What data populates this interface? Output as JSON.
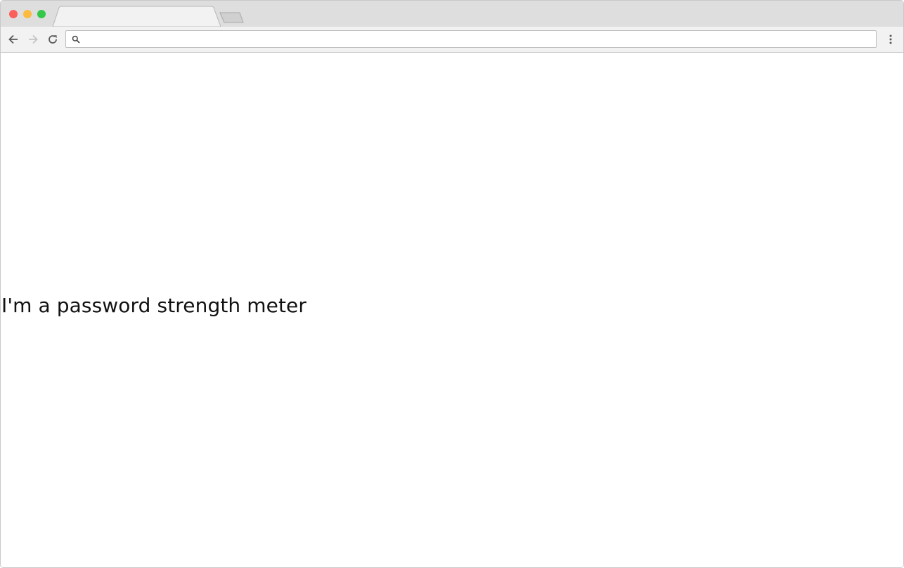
{
  "browser": {
    "active_tab_title": "",
    "address_bar": {
      "value": "",
      "placeholder": ""
    },
    "icons": {
      "back": "arrow-left-icon",
      "forward": "arrow-right-icon",
      "reload": "reload-icon",
      "search": "search-icon",
      "menu": "kebab-menu-icon"
    },
    "colors": {
      "close": "#fc605c",
      "minimize": "#fcbb40",
      "maximize": "#34c84a",
      "titlebar": "#dedede",
      "toolbar": "#f2f2f2"
    }
  },
  "page": {
    "heading": "I'm a password strength meter"
  }
}
